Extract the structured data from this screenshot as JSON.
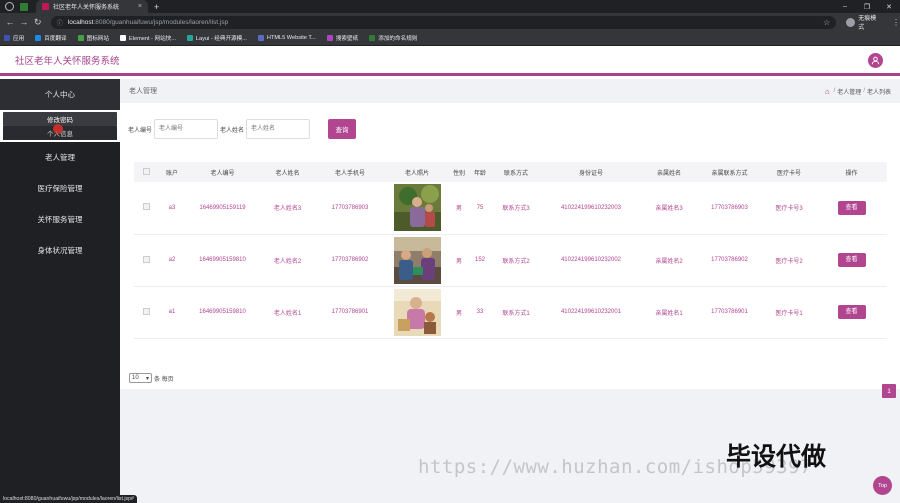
{
  "browser": {
    "tab_title": "社区老年人关怀服务系统",
    "tab_close": "×",
    "new_tab": "+",
    "address_host": "localhost",
    "address_path": ":8080/guanhuaifuwu/jsp/modules/laoren/list.jsp",
    "profile_label": "无痕模式",
    "bookmarks": [
      "应用",
      "百度翻译",
      "图标网站",
      "Element - 网站快...",
      "Layui - 经典开源模...",
      "HTML5 Website T...",
      "搜索壁纸",
      "添加的命名规则"
    ],
    "bookmark_colors": [
      "#3f51b5",
      "#1e88e5",
      "#43a047",
      "#fafafa",
      "#26a69a",
      "#5c6bc0",
      "#ab47bc",
      "#2e7d32"
    ],
    "status_url": "localhost:8080/guanhuaifuwu/jsp/modules/laoren/list.jsp#"
  },
  "app": {
    "title": "社区老年人关怀服务系统",
    "accent_color": "#b24590"
  },
  "sidebar": {
    "items": [
      {
        "label": "个人中心"
      },
      {
        "label": "修改密码"
      },
      {
        "label": "个人信息"
      },
      {
        "label": "老人管理"
      },
      {
        "label": "医疗保险管理"
      },
      {
        "label": "关怀服务管理"
      },
      {
        "label": "身体状况管理"
      }
    ]
  },
  "main": {
    "page_title": "老人管理",
    "breadcrumb": [
      "老人管理",
      "老人列表"
    ],
    "search": {
      "elder_id_label": "老人编号",
      "elder_id_placeholder": "老人编号",
      "elder_name_label": "老人姓名",
      "elder_name_placeholder": "老人姓名",
      "button": "查询"
    },
    "table": {
      "headers": [
        "",
        "账户",
        "老人编号",
        "老人姓名",
        "老人手机号",
        "老人照片",
        "性别",
        "年龄",
        "联系方式",
        "身份证号",
        "亲属姓名",
        "亲属联系方式",
        "医疗卡号",
        "操作"
      ],
      "rows": [
        {
          "account": "a3",
          "elder_id": "16469905159119",
          "name": "老人姓名3",
          "phone": "17703786903",
          "gender": "男",
          "age": "75",
          "contact": "联系方式3",
          "id_card": "410224199610232003",
          "relative_name": "亲属姓名3",
          "relative_contact": "17703786903",
          "medical_card": "医疗卡号3",
          "action": "查看"
        },
        {
          "account": "a2",
          "elder_id": "16469905159810",
          "name": "老人姓名2",
          "phone": "17703786902",
          "gender": "男",
          "age": "152",
          "contact": "联系方式2",
          "id_card": "410224199610232002",
          "relative_name": "亲属姓名2",
          "relative_contact": "17703786902",
          "medical_card": "医疗卡号2",
          "action": "查看"
        },
        {
          "account": "a1",
          "elder_id": "16469905159810",
          "name": "老人姓名1",
          "phone": "17703786901",
          "gender": "男",
          "age": "33",
          "contact": "联系方式1",
          "id_card": "410224199610232001",
          "relative_name": "亲属姓名1",
          "relative_contact": "17703786901",
          "medical_card": "医疗卡号1",
          "action": "查看"
        }
      ]
    },
    "pager": {
      "page_size": "10",
      "page_size_suffix": "条 每页",
      "current_page": "1"
    }
  },
  "overlay": {
    "watermark_url": "https://www.huzhan.com/ishop59397",
    "watermark_cn": "毕设代做",
    "top_button": "Top"
  }
}
